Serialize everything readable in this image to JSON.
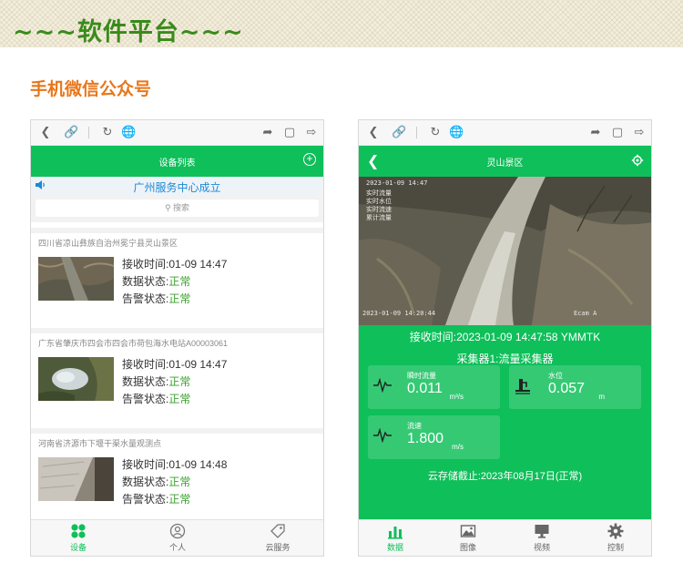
{
  "banner": {
    "title": "~~~软件平台~~~"
  },
  "section": {
    "title": "手机微信公众号"
  },
  "left_phone": {
    "header_title": "设备列表",
    "notice": "广州服务中心成立",
    "search_placeholder": "搜索",
    "devices": [
      {
        "title": "四川省凉山彝族自治州冕宁县灵山景区",
        "recv_label": "接收时间:",
        "recv_time": "01-09 14:47",
        "data_label": "数据状态:",
        "data_status": "正常",
        "alarm_label": "告警状态:",
        "alarm_status": "正常"
      },
      {
        "title": "广东省肇庆市四会市四会市荷包海水电站A00003061",
        "recv_label": "接收时间:",
        "recv_time": "01-09 14:47",
        "data_label": "数据状态:",
        "data_status": "正常",
        "alarm_label": "告警状态:",
        "alarm_status": "正常"
      },
      {
        "title": "河南省济源市下堰干渠水量观测点",
        "recv_label": "接收时间:",
        "recv_time": "01-09 14:48",
        "data_label": "数据状态:",
        "data_status": "正常",
        "alarm_label": "告警状态:",
        "alarm_status": "正常"
      }
    ],
    "tabs": [
      {
        "label": "设备",
        "icon": "grid-icon"
      },
      {
        "label": "个人",
        "icon": "user-icon"
      },
      {
        "label": "云服务",
        "icon": "tag-icon"
      }
    ]
  },
  "right_phone": {
    "header_title": "灵山景区",
    "video_overlay": {
      "timestamp": "2023-01-09 14:47",
      "lines": [
        "实时流量",
        "实时水位",
        "实时流速",
        "累计流量"
      ],
      "bottom_left": "2023-01-09 14:20:44",
      "bottom_right": "Ecam A"
    },
    "recv_time": "接收时间:2023-01-09 14:47:58 YMMTK",
    "collector": "采集器1:流量采集器",
    "metrics": [
      {
        "label": "瞬时流量",
        "value": "0.011",
        "unit": "m³/s",
        "icon": "wave-icon"
      },
      {
        "label": "水位",
        "value": "0.057",
        "unit": "m",
        "icon": "gauge-icon"
      },
      {
        "label": "流速",
        "value": "1.800",
        "unit": "m/s",
        "icon": "wave-icon"
      }
    ],
    "storage": "云存储截止:2023年08月17日(正常)",
    "tabs": [
      {
        "label": "数据",
        "icon": "bar-chart-icon"
      },
      {
        "label": "图像",
        "icon": "image-icon"
      },
      {
        "label": "视频",
        "icon": "monitor-icon"
      },
      {
        "label": "控制",
        "icon": "gear-icon"
      }
    ]
  },
  "colors": {
    "green": "#0fbf5a",
    "orange": "#e8771a",
    "banner_green": "#3a8a1c",
    "notice_blue": "#1a8ad6"
  }
}
